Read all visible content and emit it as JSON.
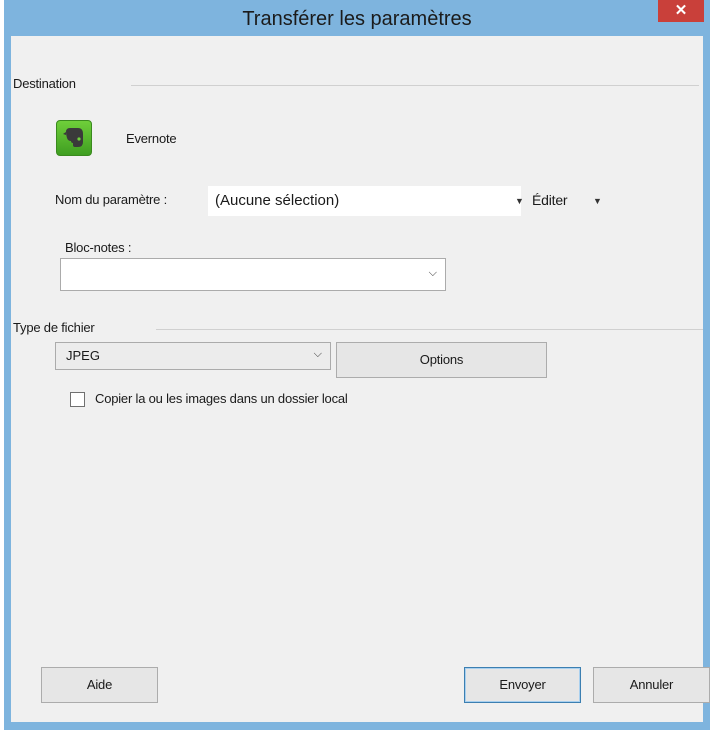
{
  "window": {
    "title": "Transférer les paramètres",
    "close_symbol": "✕"
  },
  "destination": {
    "group_label": "Destination",
    "app_name": "Evernote",
    "app_icon": "evernote-elephant-icon"
  },
  "setting": {
    "label": "Nom du paramètre :",
    "value": "(Aucune sélection)",
    "edit_label": "Éditer"
  },
  "notebook": {
    "label": "Bloc-notes :",
    "value": ""
  },
  "file_type": {
    "group_label": "Type de fichier",
    "value": "JPEG",
    "options_button": "Options",
    "copy_checkbox_label": "Copier la ou les images dans un dossier local",
    "copy_checked": false
  },
  "footer": {
    "help_button": "Aide",
    "send_button": "Envoyer",
    "cancel_button": "Annuler"
  },
  "colors": {
    "titlebar": "#7eb4de",
    "close": "#c9403a",
    "client": "#f0f0f0",
    "icon_green": "#4fae28"
  }
}
